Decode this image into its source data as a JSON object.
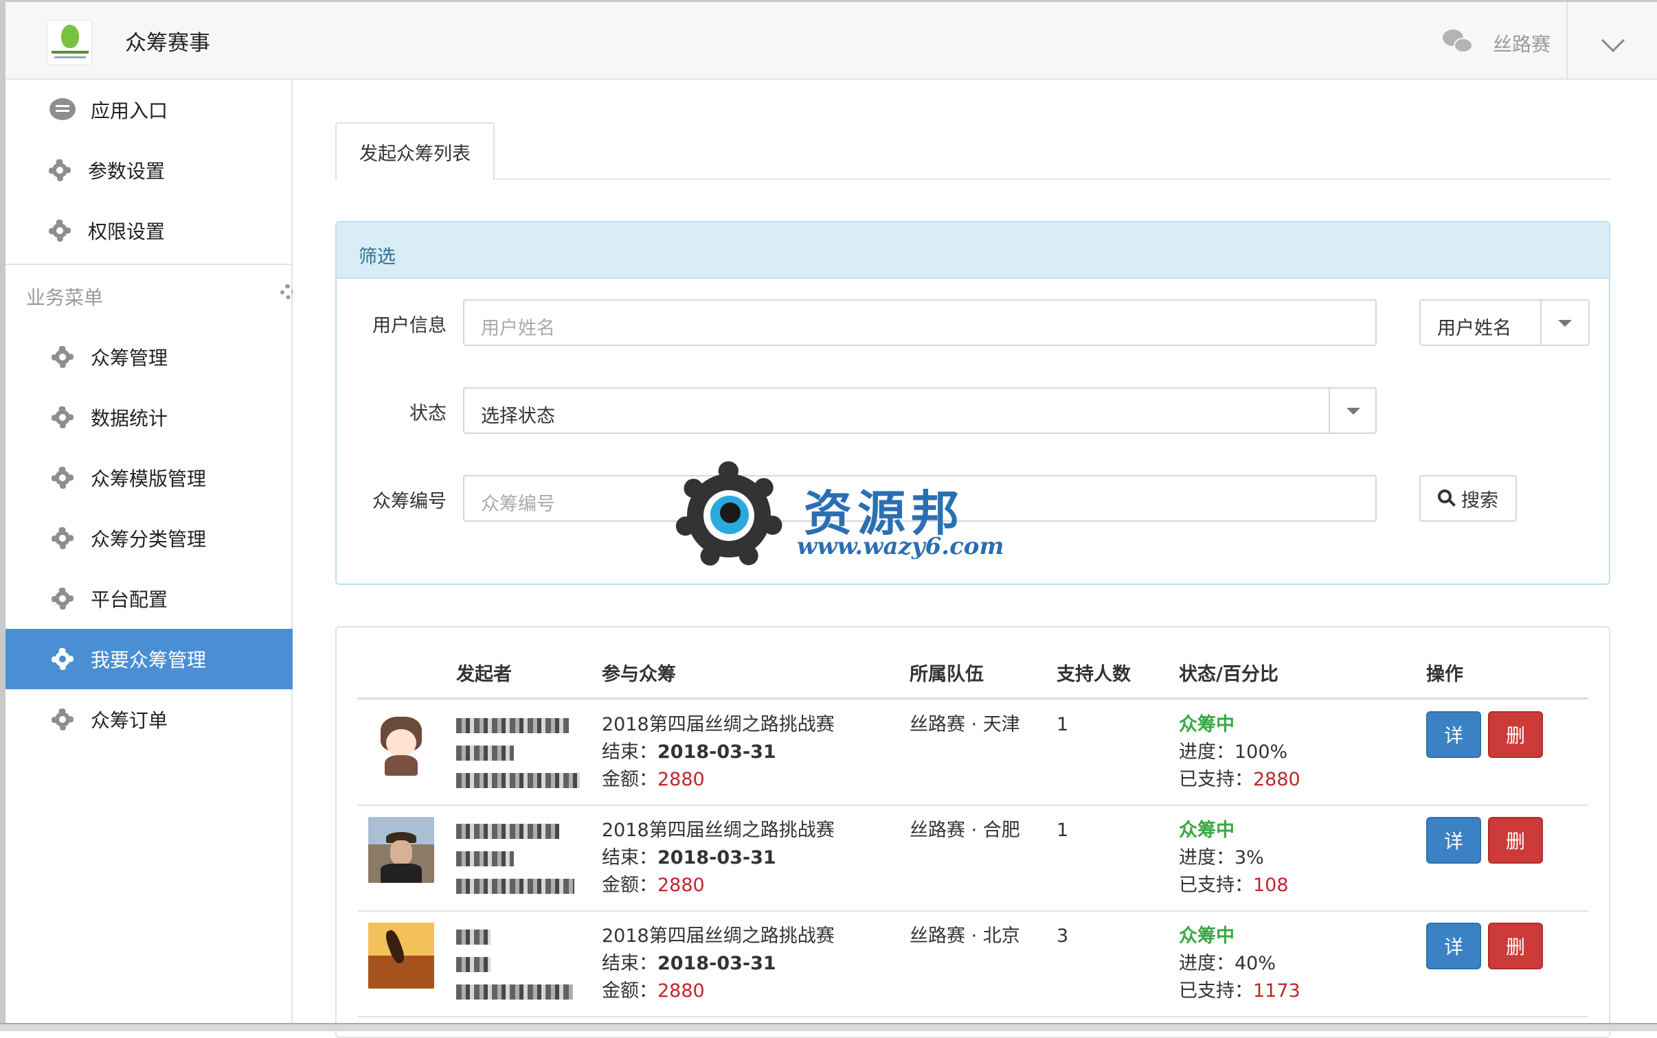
{
  "header": {
    "app_title": "众筹赛事",
    "user_name": "丝路赛"
  },
  "sidebar": {
    "top_items": [
      {
        "label": "应用入口",
        "icon": "chat-bubble-icon"
      },
      {
        "label": "参数设置",
        "icon": "gear-icon"
      },
      {
        "label": "权限设置",
        "icon": "gear-icon"
      }
    ],
    "section_title": "业务菜单",
    "items": [
      {
        "label": "众筹管理"
      },
      {
        "label": "数据统计"
      },
      {
        "label": "众筹模版管理"
      },
      {
        "label": "众筹分类管理"
      },
      {
        "label": "平台配置"
      },
      {
        "label": "我要众筹管理",
        "active": true
      },
      {
        "label": "众筹订单"
      }
    ]
  },
  "tabs": [
    {
      "label": "发起众筹列表"
    }
  ],
  "filter": {
    "title": "筛选",
    "user_info_label": "用户信息",
    "user_info_placeholder": "用户姓名",
    "user_field_select": "用户姓名",
    "status_label": "状态",
    "status_select": "选择状态",
    "number_label": "众筹编号",
    "number_placeholder": "众筹编号",
    "search_button": "搜索"
  },
  "watermark": {
    "text": "资源邦",
    "url": "www.wazy6.com"
  },
  "table": {
    "headers": [
      "发起者",
      "参与众筹",
      "所属队伍",
      "支持人数",
      "状态/百分比",
      "操作"
    ],
    "rows": [
      {
        "event": "2018第四届丝绸之路挑战赛",
        "end_label": "结束：",
        "end_date": "2018-03-31",
        "amount_label": "金额：",
        "amount": "2880",
        "team": "丝路赛 · 天津",
        "supporters": "1",
        "status": "众筹中",
        "progress_label": "进度：",
        "progress": "100%",
        "supported_label": "已支持：",
        "supported": "2880",
        "detail": "详",
        "delete": "删"
      },
      {
        "event": "2018第四届丝绸之路挑战赛",
        "end_label": "结束：",
        "end_date": "2018-03-31",
        "amount_label": "金额：",
        "amount": "2880",
        "team": "丝路赛 · 合肥",
        "supporters": "1",
        "status": "众筹中",
        "progress_label": "进度：",
        "progress": "3%",
        "supported_label": "已支持：",
        "supported": "108",
        "detail": "详",
        "delete": "删"
      },
      {
        "event": "2018第四届丝绸之路挑战赛",
        "end_label": "结束：",
        "end_date": "2018-03-31",
        "amount_label": "金额：",
        "amount": "2880",
        "team": "丝路赛 · 北京",
        "supporters": "3",
        "status": "众筹中",
        "progress_label": "进度：",
        "progress": "40%",
        "supported_label": "已支持：",
        "supported": "1173",
        "detail": "详",
        "delete": "删"
      }
    ]
  },
  "colors": {
    "accent": "#4a8fd4",
    "status_green": "#3aa845",
    "amount_red": "#c0262c",
    "delete_red": "#cc3a3a",
    "filter_head": "#d9edf7"
  }
}
